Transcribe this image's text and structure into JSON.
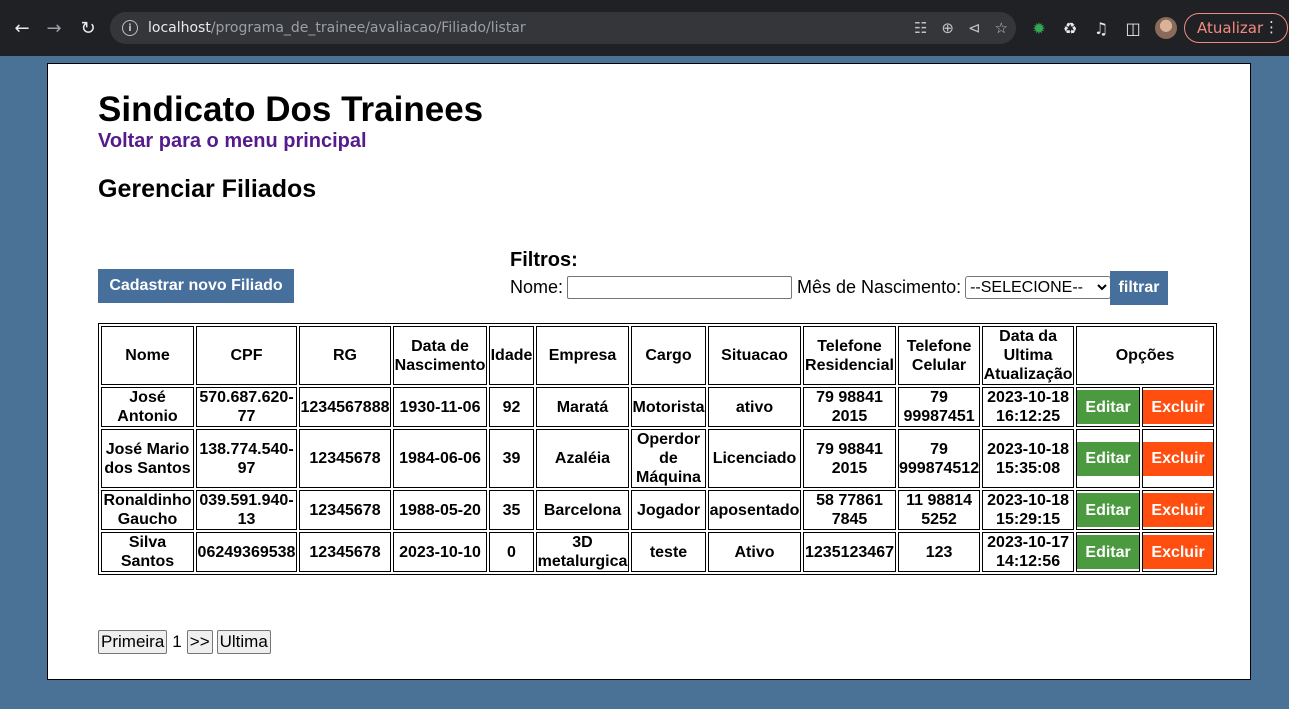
{
  "browser": {
    "url_host": "localhost",
    "url_path": "/programa_de_trainee/avaliacao/Filiado/listar",
    "update_label": "Atualizar"
  },
  "page": {
    "site_title": "Sindicato Dos Trainees",
    "back_link": "Voltar para o menu principal",
    "section_title": "Gerenciar Filiados",
    "new_button": "Cadastrar novo Filiado",
    "filters": {
      "title": "Filtros:",
      "name_label": "Nome:",
      "name_value": "",
      "month_label": "Mês de Nascimento:",
      "month_selected": "--SELECIONE--",
      "filter_button": "filtrar"
    },
    "table": {
      "headers": [
        "Nome",
        "CPF",
        "RG",
        "Data de Nascimento",
        "Idade",
        "Empresa",
        "Cargo",
        "Situacao",
        "Telefone Residencial",
        "Telefone Celular",
        "Data da Ultima Atualização",
        "Opções"
      ],
      "edit_label": "Editar",
      "delete_label": "Excluir",
      "rows": [
        [
          "José Antonio",
          "570.687.620-77",
          "1234567888",
          "1930-11-06",
          "92",
          "Maratá",
          "Motorista",
          "ativo",
          "79 98841 2015",
          "79 99987451",
          "2023-10-18 16:12:25"
        ],
        [
          "José Mario dos Santos",
          "138.774.540-97",
          "12345678",
          "1984-06-06",
          "39",
          "Azaléia",
          "Operdor de Máquina",
          "Licenciado",
          "79 98841 2015",
          "79 999874512",
          "2023-10-18 15:35:08"
        ],
        [
          "Ronaldinho Gaucho",
          "039.591.940-13",
          "12345678",
          "1988-05-20",
          "35",
          "Barcelona",
          "Jogador",
          "aposentado",
          "58 77861 7845",
          "11 98814 5252",
          "2023-10-18 15:29:15"
        ],
        [
          "Silva Santos",
          "06249369538",
          "12345678",
          "2023-10-10",
          "0",
          "3D metalurgica",
          "teste",
          "Ativo",
          "1235123467",
          "123",
          "2023-10-17 14:12:56"
        ]
      ]
    },
    "pager": {
      "first": "Primeira",
      "current": "1",
      "next": ">>",
      "last": "Ultima"
    }
  }
}
